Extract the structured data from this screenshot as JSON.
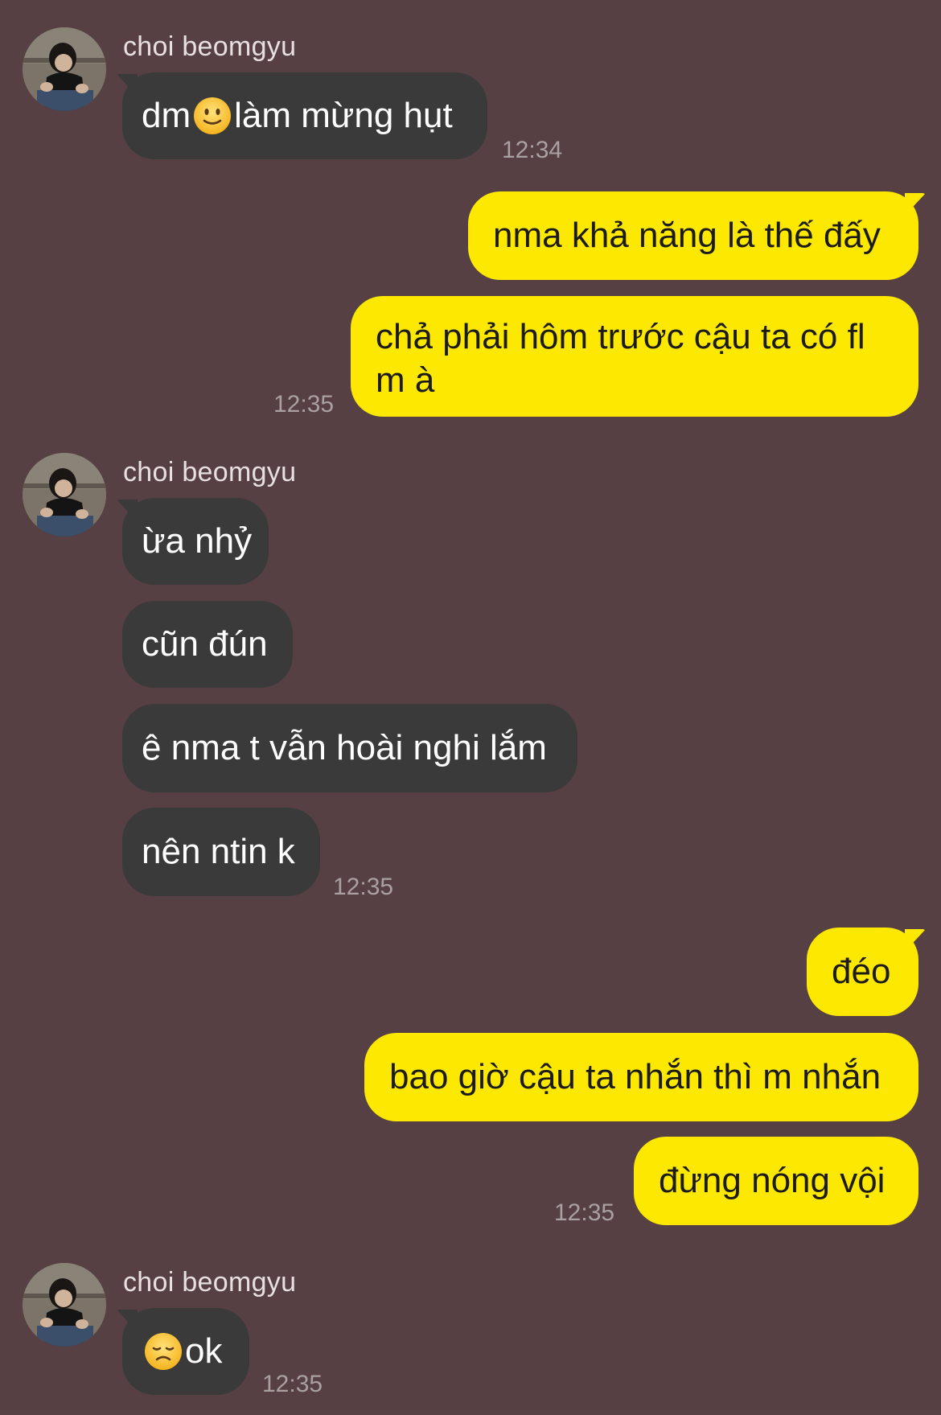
{
  "contact": {
    "name": "choi beomgyu"
  },
  "messages": [
    {
      "side": "in",
      "text_before": "dm",
      "emoji": "slightly-smiling-face",
      "text_after": "làm mừng hụt",
      "time": "12:34"
    },
    {
      "side": "out",
      "text": "nma khả năng là thế đấy"
    },
    {
      "side": "out",
      "text": "chả phải hôm trước cậu ta có fl m à",
      "time": "12:35"
    },
    {
      "side": "in",
      "text": "ừa nhỷ"
    },
    {
      "side": "in",
      "text": "cũn đún"
    },
    {
      "side": "in",
      "text": "ê nma t vẫn hoài nghi lắm"
    },
    {
      "side": "in",
      "text": "nên ntin k",
      "time": "12:35"
    },
    {
      "side": "out",
      "text": "đéo"
    },
    {
      "side": "out",
      "text": "bao giờ cậu ta nhắn thì m nhắn"
    },
    {
      "side": "out",
      "text": "đừng nóng vội",
      "time": "12:35"
    },
    {
      "side": "in",
      "emoji": "disappointed-face",
      "text_after": "ok",
      "time": "12:35"
    }
  ],
  "colors": {
    "background": "#564043",
    "incoming_bubble": "#3a3a3b",
    "outgoing_bubble": "#fce800",
    "timestamp": "#aaa0a1",
    "name": "#e8dfe0"
  }
}
